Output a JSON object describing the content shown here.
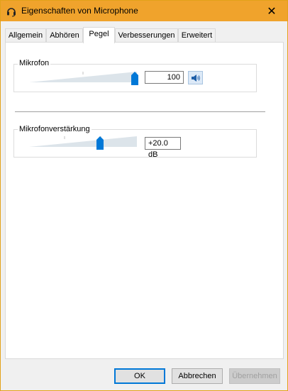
{
  "window": {
    "title": "Eigenschaften von Microphone",
    "close_symbol": "✕"
  },
  "tabs": [
    {
      "label": "Allgemein",
      "active": false
    },
    {
      "label": "Abhören",
      "active": false
    },
    {
      "label": "Pegel",
      "active": true
    },
    {
      "label": "Verbesserungen",
      "active": false
    },
    {
      "label": "Erweitert",
      "active": false
    }
  ],
  "microphone": {
    "label": "Mikrofon",
    "value": "100",
    "level_fraction": 1.0,
    "mute_icon": "speaker-icon"
  },
  "boost": {
    "label": "Mikrofonverstärkung",
    "value": "+20.0 dB",
    "level_fraction": 0.66
  },
  "buttons": {
    "ok": "OK",
    "cancel": "Abbrechen",
    "apply": "Übernehmen"
  },
  "colors": {
    "titlebar": "#f0a32c",
    "thumb": "#0078d7"
  }
}
